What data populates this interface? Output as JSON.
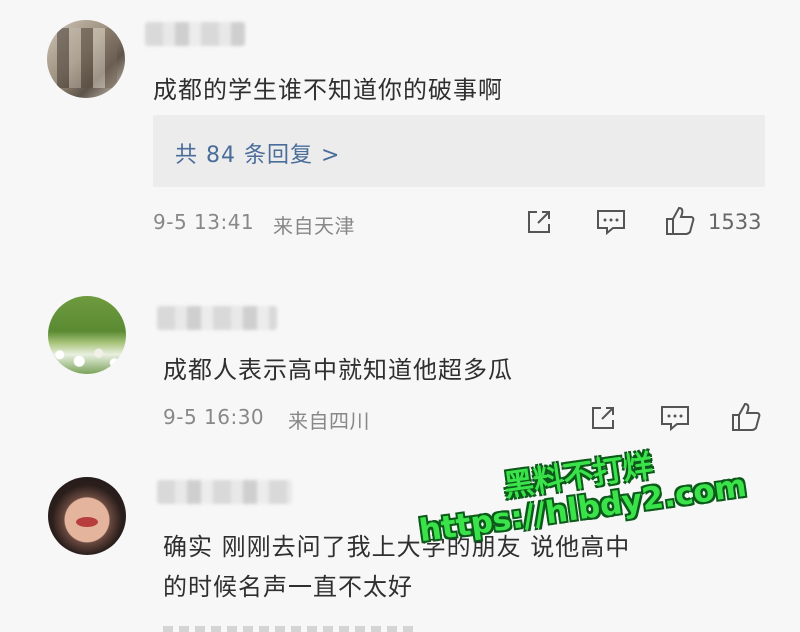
{
  "comments": [
    {
      "text": "成都的学生谁不知道你的破事啊",
      "replies_link": "共 84 条回复 >",
      "timestamp": "9-5 13:41",
      "location": "来自天津",
      "like_count": "1533"
    },
    {
      "text": "成都人表示高中就知道他超多瓜",
      "timestamp": "9-5 16:30",
      "location": "来自四川"
    },
    {
      "text_line1": "确实 刚刚去问了我上大学的朋友 说他高中",
      "text_line2": "的时候名声一直不太好"
    }
  ],
  "watermark": {
    "line1": "黑料不打烊",
    "line2": "https://hlbdy2.com"
  },
  "icons": [
    "share-icon",
    "comment-icon",
    "like-icon"
  ],
  "colors": {
    "link": "#4a6d9a",
    "watermark": "#3be34a",
    "meta": "#888888"
  }
}
